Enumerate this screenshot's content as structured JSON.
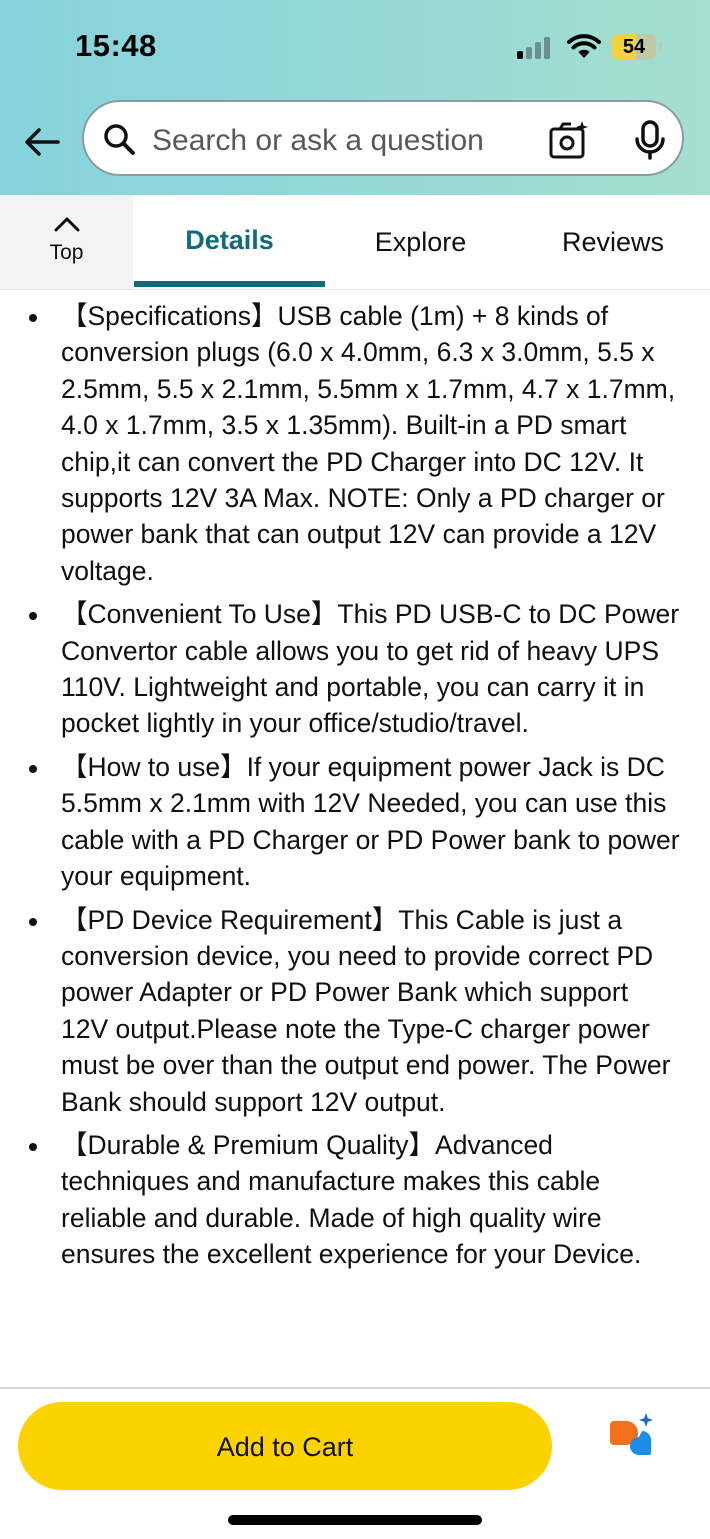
{
  "status_bar": {
    "time": "15:48",
    "battery_percent": "54",
    "signal_bars_active": 1,
    "signal_bars_total": 4
  },
  "search": {
    "placeholder": "Search or ask a question"
  },
  "icons": {
    "back": "back-arrow-icon",
    "search": "search-icon",
    "camera": "camera-icon",
    "mic": "mic-icon",
    "top": "chevron-up-icon",
    "assistant": "assistant-icon"
  },
  "tabs": {
    "top_label": "Top",
    "items": [
      {
        "label": "Details",
        "active": true
      },
      {
        "label": "Explore",
        "active": false
      },
      {
        "label": "Reviews",
        "active": false
      }
    ]
  },
  "details": {
    "bullets": [
      "【Specifications】USB cable (1m) + 8 kinds of conversion plugs (6.0 x 4.0mm, 6.3 x 3.0mm, 5.5 x 2.5mm, 5.5 x 2.1mm, 5.5mm x 1.7mm, 4.7 x 1.7mm, 4.0 x 1.7mm, 3.5 x 1.35mm). Built-in a PD smart chip,it can convert the PD Charger into DC 12V. It supports 12V 3A Max. NOTE: Only a PD charger or power bank that can output 12V can provide a 12V voltage.",
      "【Convenient To Use】This PD USB-C to DC Power Convertor cable allows you to get rid of heavy UPS 110V. Lightweight and portable, you can carry it in pocket lightly in your office/studio/travel.",
      "【How to use】If your equipment power Jack is DC 5.5mm x 2.1mm with 12V Needed, you can use this cable with a PD Charger or PD Power bank to power your equipment.",
      "【PD Device Requirement】This Cable is just a conversion device, you need to provide correct PD power Adapter or PD Power Bank which support 12V output.Please note the Type-C charger power must be over than the output end power. The Power Bank should support 12V output.",
      "【Durable & Premium Quality】Advanced techniques and manufacture makes this cable reliable and durable. Made of high quality wire ensures the excellent experience for your Device."
    ]
  },
  "bottom_bar": {
    "add_to_cart_label": "Add to Cart"
  },
  "colors": {
    "header_gradient_start": "#86d3de",
    "header_gradient_end": "#a5dfcf",
    "tab_active": "#126b7c",
    "add_to_cart": "#fcd200",
    "battery_fill": "#f2d33f",
    "assistant_orange": "#f2701c",
    "assistant_blue": "#1a8ee8"
  }
}
